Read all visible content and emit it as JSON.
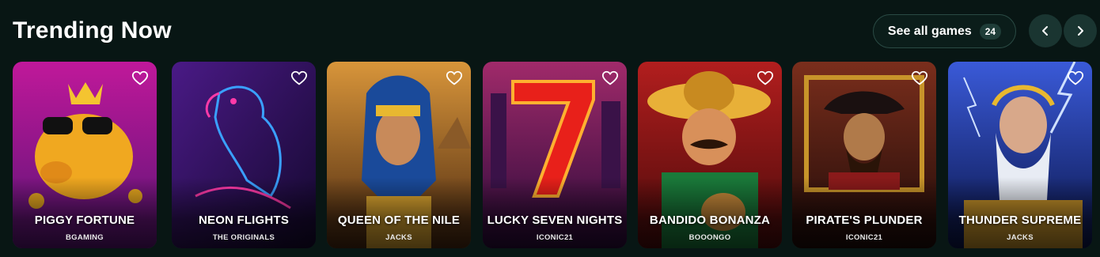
{
  "section": {
    "title": "Trending Now",
    "see_all_label": "See all games",
    "see_all_count": "24"
  },
  "icons": {
    "prev": "chevron-left-icon",
    "next": "chevron-right-icon",
    "favorite": "heart-outline-icon"
  },
  "games": [
    {
      "name": "PIGGY FORTUNE",
      "provider": "BGAMING",
      "colors": [
        "#c0189a",
        "#5a1476"
      ]
    },
    {
      "name": "NEON FLIGHTS",
      "provider": "THE ORIGINALS",
      "colors": [
        "#3b0f6e",
        "#180a3a"
      ]
    },
    {
      "name": "QUEEN OF THE NILE",
      "provider": "JACKS",
      "colors": [
        "#b8742a",
        "#5a3212"
      ]
    },
    {
      "name": "LUCKY SEVEN NIGHTS",
      "provider": "ICONIC21",
      "colors": [
        "#8c1c58",
        "#3a0c3c"
      ]
    },
    {
      "name": "BANDIDO BONANZA",
      "provider": "BOOONGO",
      "colors": [
        "#a2181a",
        "#5a0a0e"
      ]
    },
    {
      "name": "PIRATE'S PLUNDER",
      "provider": "ICONIC21",
      "colors": [
        "#6a2418",
        "#2a0e0c"
      ]
    },
    {
      "name": "THUNDER SUPREME",
      "provider": "JACKS",
      "colors": [
        "#2a4ab8",
        "#0c1a5a"
      ]
    }
  ]
}
